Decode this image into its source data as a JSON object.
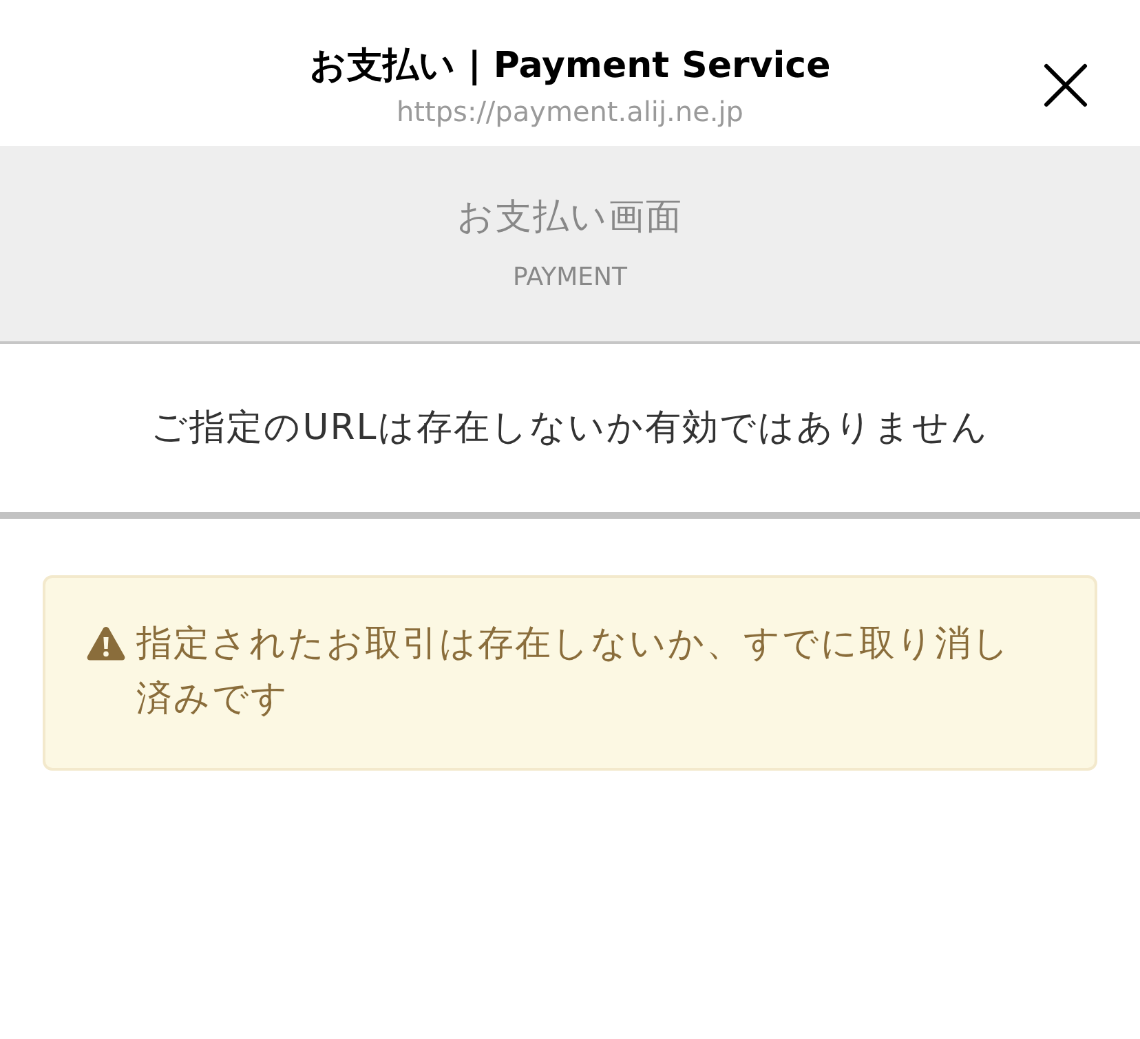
{
  "header": {
    "title": "お支払い | Payment Service",
    "url": "https://payment.alij.ne.jp"
  },
  "page_heading": {
    "title": "お支払い画面",
    "subtitle": "PAYMENT"
  },
  "message": "ご指定のURLは存在しないか有効ではありません",
  "alert": {
    "text": "指定されたお取引は存在しないか、すでに取り消し済みです"
  }
}
